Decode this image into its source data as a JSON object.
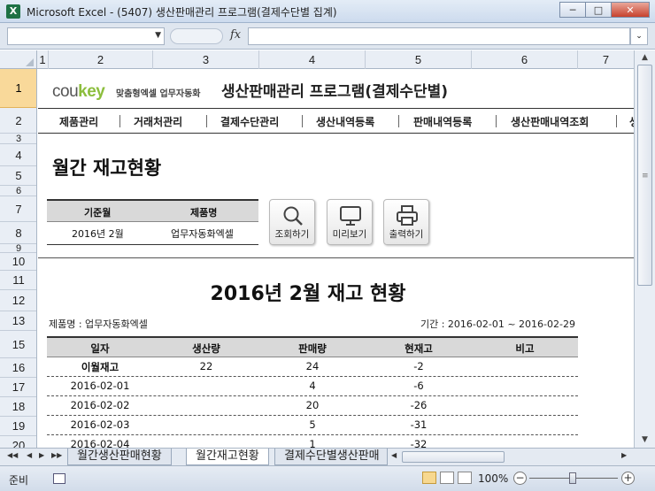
{
  "window": {
    "title": "Microsoft Excel - (5407) 생산판매관리 프로그램(결제수단별 집계)",
    "app_letter": "X"
  },
  "formula_bar": {
    "fx": "fx",
    "name_box": "",
    "formula": ""
  },
  "columns": [
    "1",
    "2",
    "3",
    "4",
    "5",
    "6",
    "7"
  ],
  "rows": [
    "1",
    "2",
    "3",
    "4",
    "5",
    "6",
    "7",
    "8",
    "9",
    "10",
    "11",
    "12",
    "13",
    "15",
    "16",
    "17",
    "18",
    "19",
    "20"
  ],
  "logo": {
    "co": "cou",
    "key": "key",
    "sub": "맞춤형엑셀 업무자동화"
  },
  "app_title": "생산판매관리 프로그램(결제수단별)",
  "nav": [
    "제품관리",
    "거래처관리",
    "결제수단관리",
    "생산내역등록",
    "판매내역등록",
    "생산판매내역조회",
    "생"
  ],
  "section_title": "월간 재고현황",
  "filter": {
    "headers": [
      "기준월",
      "제품명"
    ],
    "values": [
      "2016년 2월",
      "업무자동화엑셀"
    ]
  },
  "buttons": {
    "search": "조회하기",
    "preview": "미리보기",
    "print": "출력하기"
  },
  "report": {
    "title": "2016년 2월 재고 현황",
    "product_label": "제품명 : 업무자동화엑셀",
    "period_label": "기간 : 2016-02-01 ~ 2016-02-29",
    "headers": [
      "일자",
      "생산량",
      "판매량",
      "현재고",
      "비고"
    ],
    "rows": [
      {
        "date": "이월재고",
        "produced": "22",
        "sold": "24",
        "stock": "-2",
        "note": ""
      },
      {
        "date": "2016-02-01",
        "produced": "",
        "sold": "4",
        "stock": "-6",
        "note": ""
      },
      {
        "date": "2016-02-02",
        "produced": "",
        "sold": "20",
        "stock": "-26",
        "note": ""
      },
      {
        "date": "2016-02-03",
        "produced": "",
        "sold": "5",
        "stock": "-31",
        "note": ""
      },
      {
        "date": "2016-02-04",
        "produced": "",
        "sold": "1",
        "stock": "-32",
        "note": ""
      }
    ]
  },
  "sheet_tabs": [
    "월간생산판매현황",
    "월간재고현황",
    "결제수단별생산판매"
  ],
  "active_tab": 1,
  "status": {
    "ready": "준비",
    "zoom": "100%"
  },
  "colors": {
    "accent": "#8cbe3d",
    "row_selected": "#f9d99a",
    "header_fill": "#d9d9d9"
  }
}
